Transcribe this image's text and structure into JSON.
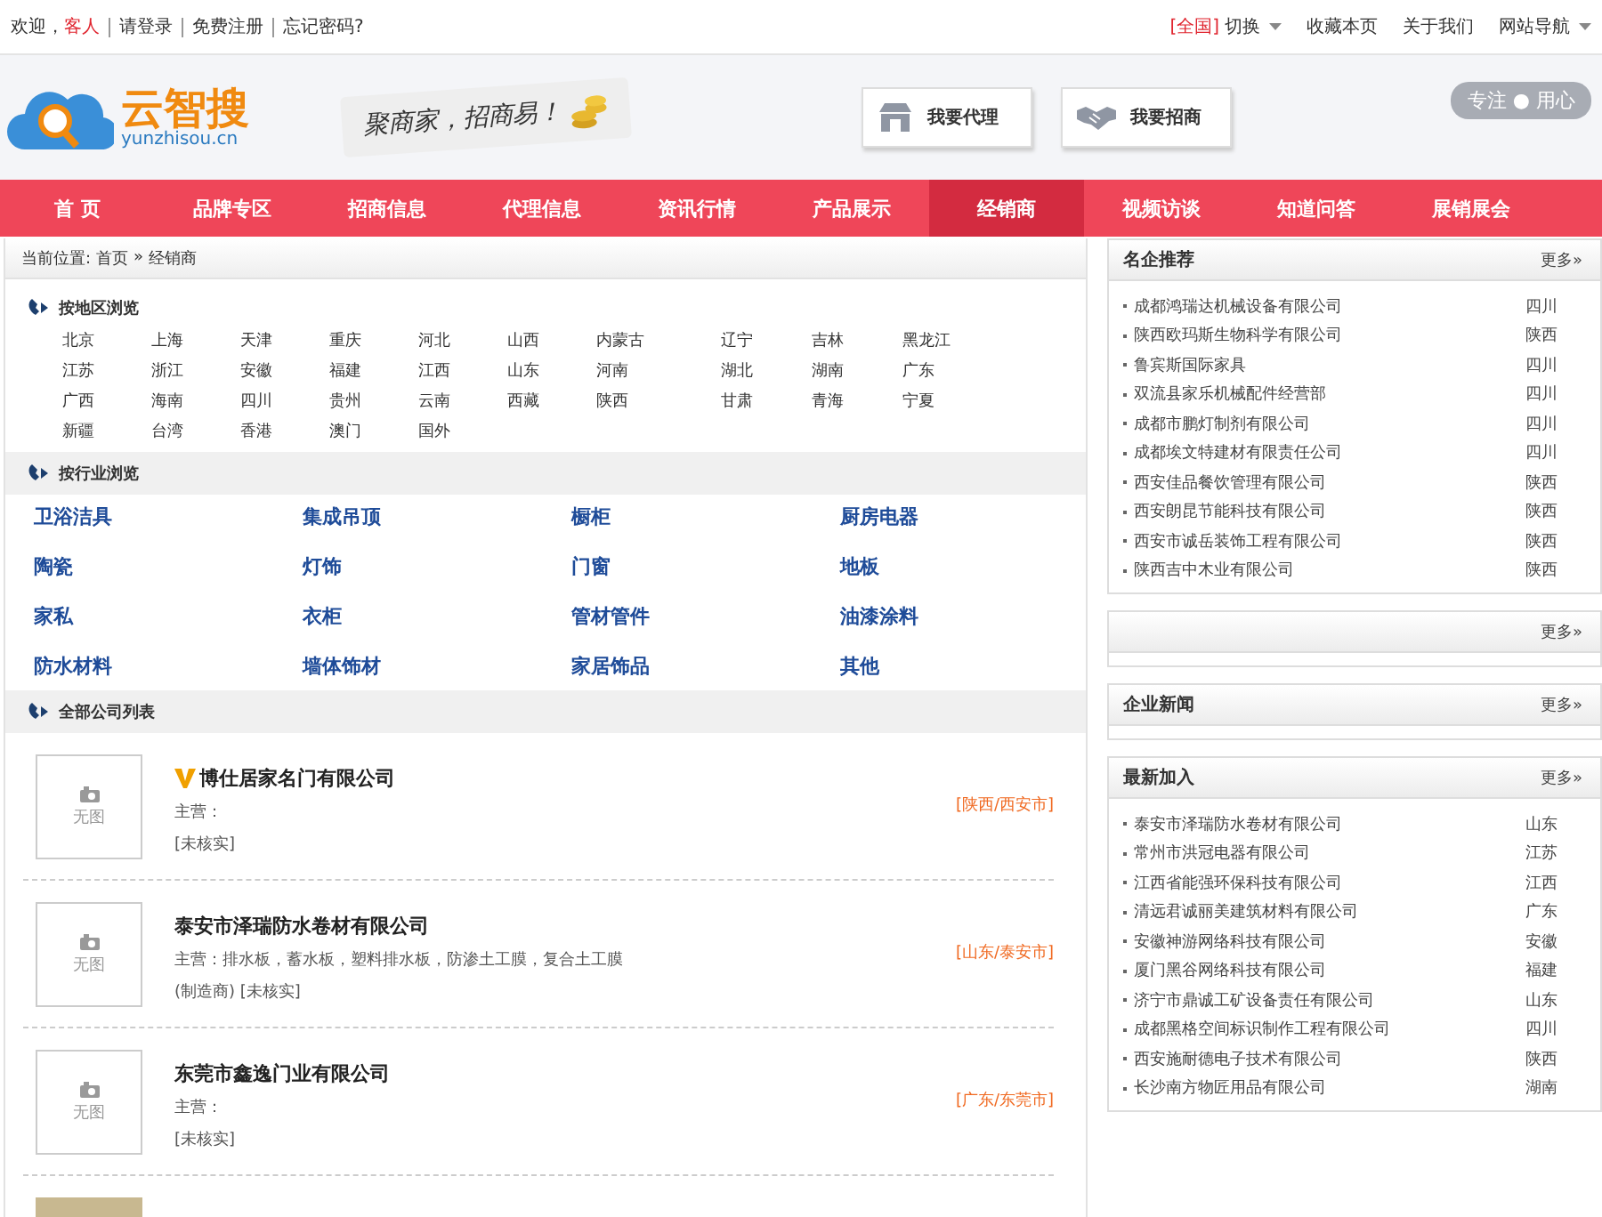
{
  "top_bar": {
    "greeting": "欢迎，",
    "user": "客人",
    "links": [
      "请登录",
      "免费注册",
      "忘记密码?"
    ],
    "region": "[全国]",
    "switch": "切换",
    "right_links": [
      "收藏本页",
      "关于我们"
    ],
    "site_nav": "网站导航"
  },
  "header": {
    "logo": {
      "name": "云智搜",
      "domain": "yunzhisou.cn"
    },
    "slogan": "聚商家，招商易！",
    "buttons": [
      {
        "kind": "store",
        "label": "我要代理"
      },
      {
        "kind": "handshake",
        "label": "我要招商"
      }
    ],
    "motto": "专注 ● 用心"
  },
  "nav": [
    {
      "label": "首 页",
      "selected": false
    },
    {
      "label": "品牌专区",
      "selected": false
    },
    {
      "label": "招商信息",
      "selected": false
    },
    {
      "label": "代理信息",
      "selected": false
    },
    {
      "label": "资讯行情",
      "selected": false
    },
    {
      "label": "产品展示",
      "selected": false
    },
    {
      "label": "经销商",
      "selected": true
    },
    {
      "label": "视频访谈",
      "selected": false
    },
    {
      "label": "知道问答",
      "selected": false
    },
    {
      "label": "展销展会",
      "selected": false
    }
  ],
  "breadcrumb": {
    "label": "当前位置:",
    "items": [
      "首页",
      "经销商"
    ],
    "separator": "»"
  },
  "regions": {
    "title": "按地区浏览",
    "items": [
      "北京",
      "上海",
      "天津",
      "重庆",
      "河北",
      "山西",
      "内蒙古",
      "辽宁",
      "吉林",
      "黑龙江",
      "江苏",
      "浙江",
      "安徽",
      "福建",
      "江西",
      "山东",
      "河南",
      "湖北",
      "湖南",
      "广东",
      "广西",
      "海南",
      "四川",
      "贵州",
      "云南",
      "西藏",
      "陕西",
      "甘肃",
      "青海",
      "宁夏",
      "新疆",
      "台湾",
      "香港",
      "澳门",
      "国外"
    ]
  },
  "industries": {
    "title": "按行业浏览",
    "items": [
      "卫浴洁具",
      "集成吊顶",
      "橱柜",
      "厨房电器",
      "陶瓷",
      "灯饰",
      "门窗",
      "地板",
      "家私",
      "衣柜",
      "管材管件",
      "油漆涂料",
      "防水材料",
      "墙体饰材",
      "家居饰品",
      "其他"
    ]
  },
  "companies": {
    "title": "全部公司列表",
    "items": [
      {
        "thumb": "无图",
        "vip": true,
        "name": "博仕居家名门有限公司",
        "main": "主营：",
        "tags": "[未核实]",
        "location": "[陕西/西安市]"
      },
      {
        "thumb": "无图",
        "vip": false,
        "name": "泰安市泽瑞防水卷材有限公司",
        "main": "主营：排水板，蓄水板，塑料排水板，防渗土工膜，复合土工膜",
        "tags": "(制造商) [未核实]",
        "location": "[山东/泰安市]"
      },
      {
        "thumb": "无图",
        "vip": false,
        "name": "东莞市鑫逸门业有限公司",
        "main": "主营：",
        "tags": "[未核实]",
        "location": "[广东/东莞市]"
      },
      {
        "kind": "picture"
      }
    ]
  },
  "side_panels": [
    {
      "title": "名企推荐",
      "more": "更多»",
      "items": [
        {
          "name": "成都鸿瑞达机械设备有限公司",
          "province": "四川"
        },
        {
          "name": "陕西欧玛斯生物科学有限公司",
          "province": "陕西"
        },
        {
          "name": "鲁宾斯国际家具",
          "province": "四川"
        },
        {
          "name": "双流县家乐机械配件经营部",
          "province": "四川"
        },
        {
          "name": "成都市鹏灯制剂有限公司",
          "province": "四川"
        },
        {
          "name": "成都埃文特建材有限责任公司",
          "province": "四川"
        },
        {
          "name": "西安佳品餐饮管理有限公司",
          "province": "陕西"
        },
        {
          "name": "西安朗昆节能科技有限公司",
          "province": "陕西"
        },
        {
          "name": "西安市诚岳装饰工程有限公司",
          "province": "陕西"
        },
        {
          "name": "陕西吉中木业有限公司",
          "province": "陕西"
        }
      ]
    },
    {
      "more": "更多»"
    },
    {
      "title": "企业新闻",
      "more": "更多»"
    },
    {
      "title": "最新加入",
      "more": "更多»",
      "items": [
        {
          "name": "泰安市泽瑞防水卷材有限公司",
          "province": "山东"
        },
        {
          "name": "常州市洪冠电器有限公司",
          "province": "江苏"
        },
        {
          "name": "江西省能强环保科技有限公司",
          "province": "江西"
        },
        {
          "name": "清远君诚丽美建筑材料有限公司",
          "province": "广东"
        },
        {
          "name": "安徽神游网络科技有限公司",
          "province": "安徽"
        },
        {
          "name": "厦门黑谷网络科技有限公司",
          "province": "福建"
        },
        {
          "name": "济宁市鼎诚工矿设备责任有限公司",
          "province": "山东"
        },
        {
          "name": "成都黑格空间标识制作工程有限公司",
          "province": "四川"
        },
        {
          "name": "西安施耐德电子技术有限公司",
          "province": "陕西"
        },
        {
          "name": "长沙南方物匠用品有限公司",
          "province": "湖南"
        }
      ]
    }
  ]
}
